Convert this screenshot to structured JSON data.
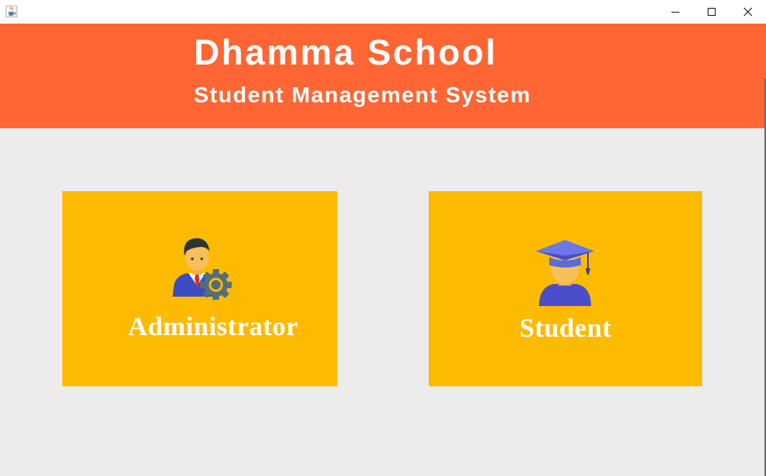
{
  "window": {
    "app_icon": "java-cup-icon",
    "controls": {
      "minimize_icon": "minimize-icon",
      "maximize_icon": "maximize-icon",
      "close_icon": "close-icon"
    }
  },
  "header": {
    "title": "Dhamma School",
    "subtitle": "Student Management System"
  },
  "cards": {
    "administrator": {
      "label": "Administrator",
      "icon": "admin-settings-icon"
    },
    "student": {
      "label": "Student",
      "icon": "graduate-student-icon"
    }
  },
  "colors": {
    "header_bg": "#ff6633",
    "card_bg": "#fdbb00",
    "page_bg": "#ececec"
  }
}
